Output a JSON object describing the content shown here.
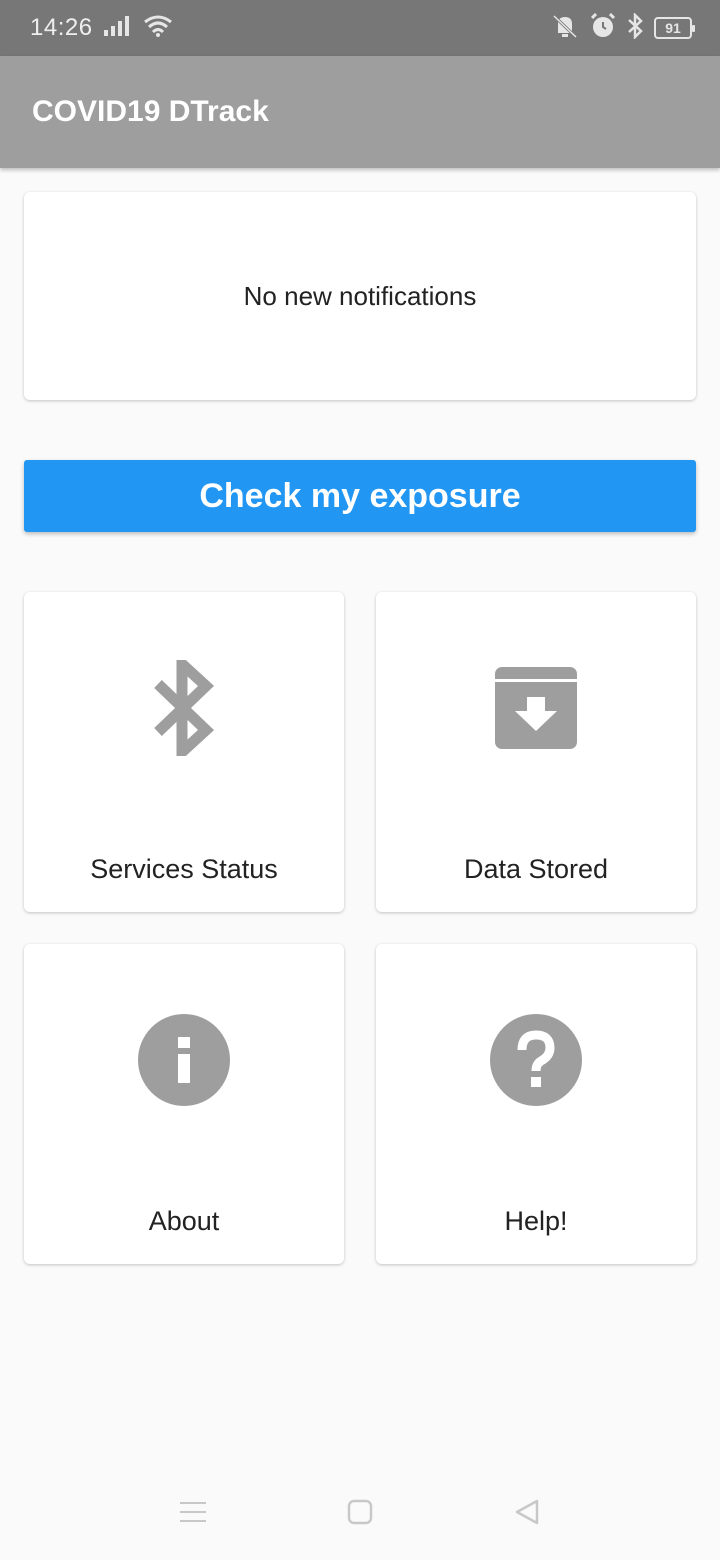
{
  "status_bar": {
    "time": "14:26",
    "battery": "91",
    "icons": [
      "signal-icon",
      "wifi-icon",
      "vibrate-icon",
      "alarm-icon",
      "bluetooth-icon",
      "battery-icon"
    ]
  },
  "app_bar": {
    "title": "COVID19 DTrack",
    "color": "#9e9e9e"
  },
  "notifications": {
    "text": "No new notifications"
  },
  "exposure_button": {
    "label": "Check my exposure",
    "color": "#2196f3"
  },
  "tiles": [
    {
      "label": "Services Status",
      "icon": "bluetooth-icon"
    },
    {
      "label": "Data Stored",
      "icon": "archive-download-icon"
    },
    {
      "label": "About",
      "icon": "info-icon"
    },
    {
      "label": "Help!",
      "icon": "help-icon"
    }
  ],
  "nav_bar": {
    "icons": [
      "menu-icon",
      "home-icon",
      "back-icon"
    ]
  },
  "colors": {
    "icon_gray": "#9e9e9e",
    "background": "#fafafa"
  }
}
